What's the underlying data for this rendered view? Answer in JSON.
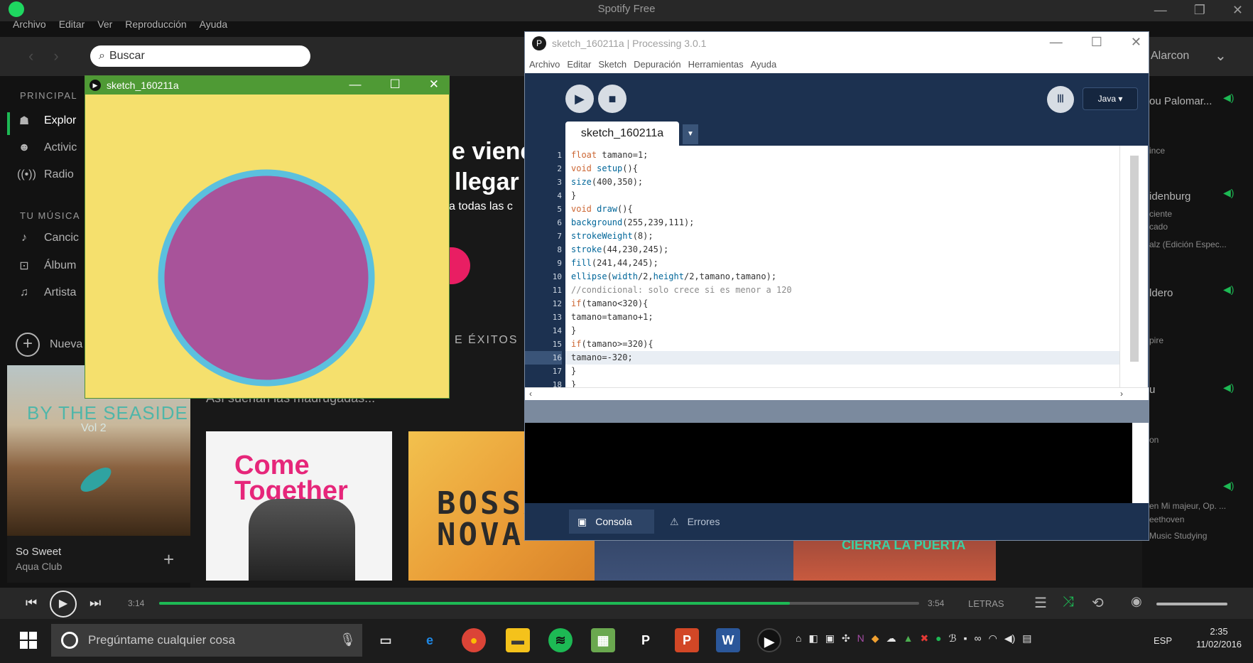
{
  "spotify": {
    "window_title": "Spotify Free",
    "menu": [
      "Archivo",
      "Editar",
      "Ver",
      "Reproducción",
      "Ayuda"
    ],
    "search_placeholder": "Buscar",
    "user_name": "Alarcon",
    "sidebar": {
      "principal_header": "PRINCIPAL",
      "principal_items": [
        {
          "label": "Explor",
          "icon": "radio-tower-icon"
        },
        {
          "label": "Activic",
          "icon": "activity-icon"
        },
        {
          "label": "Radio",
          "icon": "radio-icon"
        }
      ],
      "music_header": "TU MÚSICA",
      "music_items": [
        {
          "label": "Cancic",
          "icon": "songs-icon"
        },
        {
          "label": "Álbum",
          "icon": "album-icon"
        },
        {
          "label": "Artista",
          "icon": "artist-icon"
        }
      ],
      "new_playlist_label": "Nueva"
    },
    "now_playing": {
      "album_title": "BY THE SEASIDE",
      "album_subtitle": "Vol 2",
      "track": "So Sweet",
      "artist": "Aqua Club"
    },
    "main": {
      "hero_line1": "e viene",
      "hero_line2": "llegar",
      "hero_line3": "a todas las c",
      "section_heading": "E ÉXITOS",
      "section_subtitle": "Así suenan las madrugadas...",
      "cards": [
        {
          "title": "Come Together"
        },
        {
          "title": "BOSSA NOVA"
        },
        {
          "title": ""
        },
        {
          "title": "CIERRA LA PUERTA"
        }
      ]
    },
    "friend_feed": [
      {
        "text": "ou Palomar..."
      },
      {
        "text": "ince"
      },
      {
        "text": "idenburg"
      },
      {
        "text": "ciente"
      },
      {
        "text": "cado"
      },
      {
        "text": "alz (Edición Espec..."
      },
      {
        "text": "ldero"
      },
      {
        "text": "pire"
      },
      {
        "text": "u"
      },
      {
        "text": "on"
      },
      {
        "text": "en Mi majeur, Op. ..."
      },
      {
        "text": "eethoven"
      },
      {
        "text": "Music Studying"
      }
    ],
    "playbar": {
      "elapsed": "3:14",
      "total": "3:54",
      "progress_fraction": 0.83,
      "lyrics_label": "LETRAS"
    },
    "colors": {
      "accent": "#1db954",
      "background": "#121212"
    }
  },
  "processing": {
    "window_title": "sketch_160211a | Processing 3.0.1",
    "menu": [
      "Archivo",
      "Editar",
      "Sketch",
      "Depuración",
      "Herramientas",
      "Ayuda"
    ],
    "mode": "Java ▾",
    "tab_name": "sketch_160211a",
    "code_lines": [
      "float tamano=1;",
      "void setup(){",
      "size(400,350);",
      "}",
      "void draw(){",
      "background(255,239,111);",
      "strokeWeight(8);",
      "stroke(44,230,245);",
      "fill(241,44,245);",
      "ellipse(width/2,height/2,tamano,tamano);",
      "//condicional: solo crece si es menor a 120",
      "if(tamano<320){",
      "tamano=tamano+1;",
      "}",
      "if(tamano>=320){",
      "tamano=-320;",
      "}",
      "}",
      ""
    ],
    "highlighted_line": 16,
    "console_tab": "Consola",
    "errors_tab": "Errores",
    "colors": {
      "chrome": "#1c3150",
      "keyword": "#cc6633",
      "function": "#006699"
    }
  },
  "sketch_window": {
    "title": "sketch_160211a",
    "background": "#f5e06d",
    "stroke": "#5bc0de",
    "fill": "#a8539a"
  },
  "taskbar": {
    "search_placeholder": "Pregúntame cualquier cosa",
    "language": "ESP",
    "time": "2:35",
    "date": "11/02/2016"
  }
}
